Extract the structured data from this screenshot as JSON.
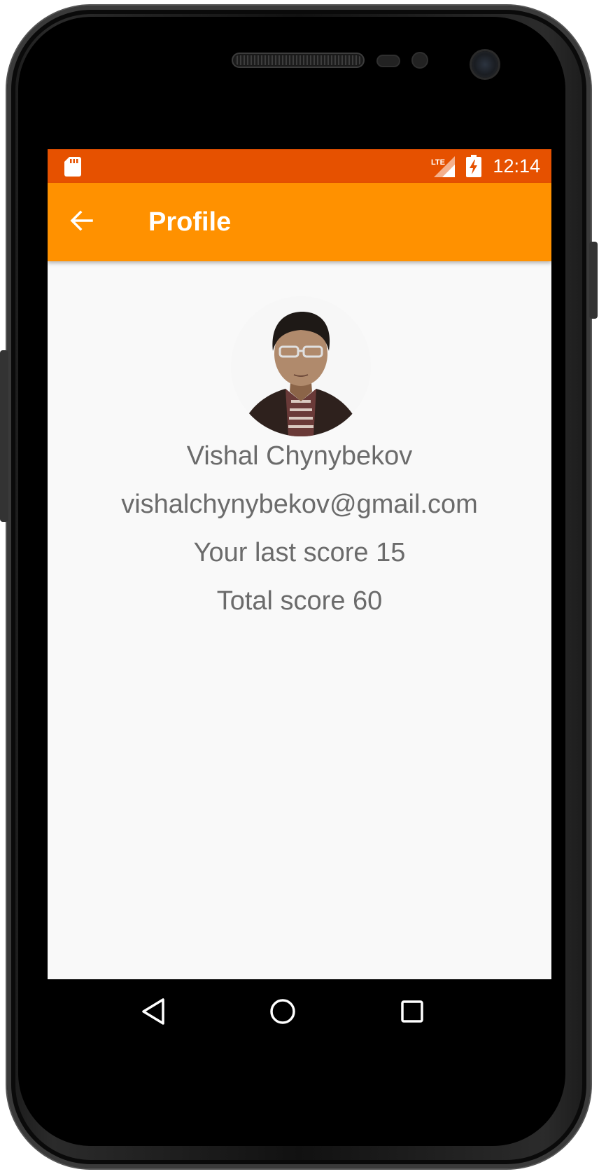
{
  "status_bar": {
    "time": "12:14",
    "network_label": "LTE",
    "icons": [
      "sd-card-icon",
      "lte-signal-icon",
      "battery-charging-icon"
    ]
  },
  "app_bar": {
    "title": "Profile",
    "back_icon": "arrow-back-icon"
  },
  "profile": {
    "avatar_icon": "profile-photo",
    "name": "Vishal Chynybekov",
    "email": "vishalchynybekov@gmail.com",
    "last_score": "Your last score 15",
    "total_score": "Total score 60"
  },
  "nav_bar": {
    "buttons": [
      "back-triangle-icon",
      "home-circle-icon",
      "recents-square-icon"
    ]
  },
  "colors": {
    "status_bar": "#e65100",
    "app_bar": "#ff9100",
    "background": "#f9f9f9",
    "text": "#6b6b6b"
  }
}
